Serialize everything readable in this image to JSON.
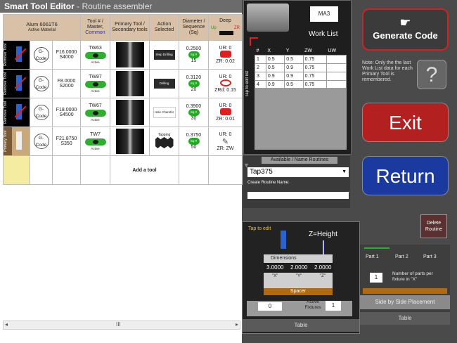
{
  "window": {
    "title": "Smart Tool Editor",
    "subtitle": "- Routine assembler"
  },
  "material": {
    "name": "Alum 6061T6",
    "label": "Active Material"
  },
  "headers": {
    "tool": "Tool # / Master,",
    "tool_common": "Common",
    "primary": "Primary Tool / Secondary tools",
    "action": "Action Selected",
    "diameter": "Diameter / Sequence (Sq)",
    "deep": "Deep",
    "deep_up": "Up",
    "deep_zr": "ZR"
  },
  "rows": [
    {
      "side": "Remove Tool",
      "gcode": "G-Code",
      "feed": "F16.0000",
      "speed": "S4000",
      "tool_no": "TW63",
      "active": "Active",
      "action": "Step Drilling",
      "dia": "0.2500",
      "sq": "Sq #",
      "seq": "15",
      "ur": "UR: 0",
      "zr": "ZR: 0.02"
    },
    {
      "side": "Remove Tool",
      "gcode": "G-Code",
      "feed": "F8.0000",
      "speed": "S2000",
      "tool_no": "TW87",
      "active": "Active",
      "action": "Drilling",
      "dia": "0.3120",
      "sq": "Sq #",
      "seq": "20",
      "ur": "UR: 0",
      "zr": "ZRd: 0.15"
    },
    {
      "side": "Remove Tool",
      "gcode": "G-Code",
      "feed": "F18.0000",
      "speed": "S4500",
      "tool_no": "TW67",
      "active": "Active",
      "action": "Hole Chamfer",
      "dia": "0.3900",
      "sq": "Sq #",
      "seq": "30",
      "ur": "UR: 0",
      "zr": "ZR: 0.01"
    },
    {
      "side": "Primary Tool",
      "gcode": "G-Code",
      "feed": "F21.8750",
      "speed": "S350",
      "tool_no": "TW7",
      "active": "Active",
      "action": "Tapping",
      "dia": "0.3750",
      "sq": "Sq #",
      "seq": "50",
      "ur": "UR: 0",
      "zr": "ZR: ZW"
    }
  ],
  "add_tool": "Add a tool",
  "scroll_mark": "III",
  "machine": {
    "label": "MA3",
    "title": "Work List",
    "tap_edit": "Tap to edit list"
  },
  "worklist": {
    "cols": [
      "#",
      "X",
      "Y",
      "ZW",
      "UW"
    ],
    "rows": [
      [
        "1",
        "0.5",
        "0.5",
        "0.75",
        ""
      ],
      [
        "2",
        "0.5",
        "0.9",
        "0.75",
        ""
      ],
      [
        "3",
        "0.9",
        "0.9",
        "0.75",
        ""
      ],
      [
        "4",
        "0.9",
        "0.5",
        "0.75",
        ""
      ]
    ]
  },
  "routine": {
    "header": "Available / Name Routines",
    "selected": "Tap375",
    "create_label": "Create Routine Name:",
    "name_value": ""
  },
  "buttons": {
    "generate": "Generate Code",
    "exit": "Exit",
    "return": "Return",
    "help": "?",
    "delete": "Delete Routine"
  },
  "note": "Note: Only the the last Work List data for each Primary Tool is remembered.",
  "setup": {
    "tap_edit": "Tap to edit",
    "z_height": "Z=Height",
    "dims_label": "Dimensions",
    "dim_x": "3.0000",
    "dim_y": "2.0000",
    "dim_z": "2.0000",
    "lbl_x": "\"X\"",
    "lbl_y": "\"Y\"",
    "lbl_z": "\"Z\"",
    "spacer": "Spacer",
    "spacer_val": "0",
    "fixtures_label": "Active Fixtures",
    "fixtures_val": "1",
    "table_label": "Table"
  },
  "placement": {
    "parts": [
      "Part 1",
      "Part 2",
      "Part 3"
    ],
    "count": "1",
    "count_label": "Number of parts per fixture in \"X\"",
    "title": "Side by Side Placement",
    "table_label": "Table"
  }
}
